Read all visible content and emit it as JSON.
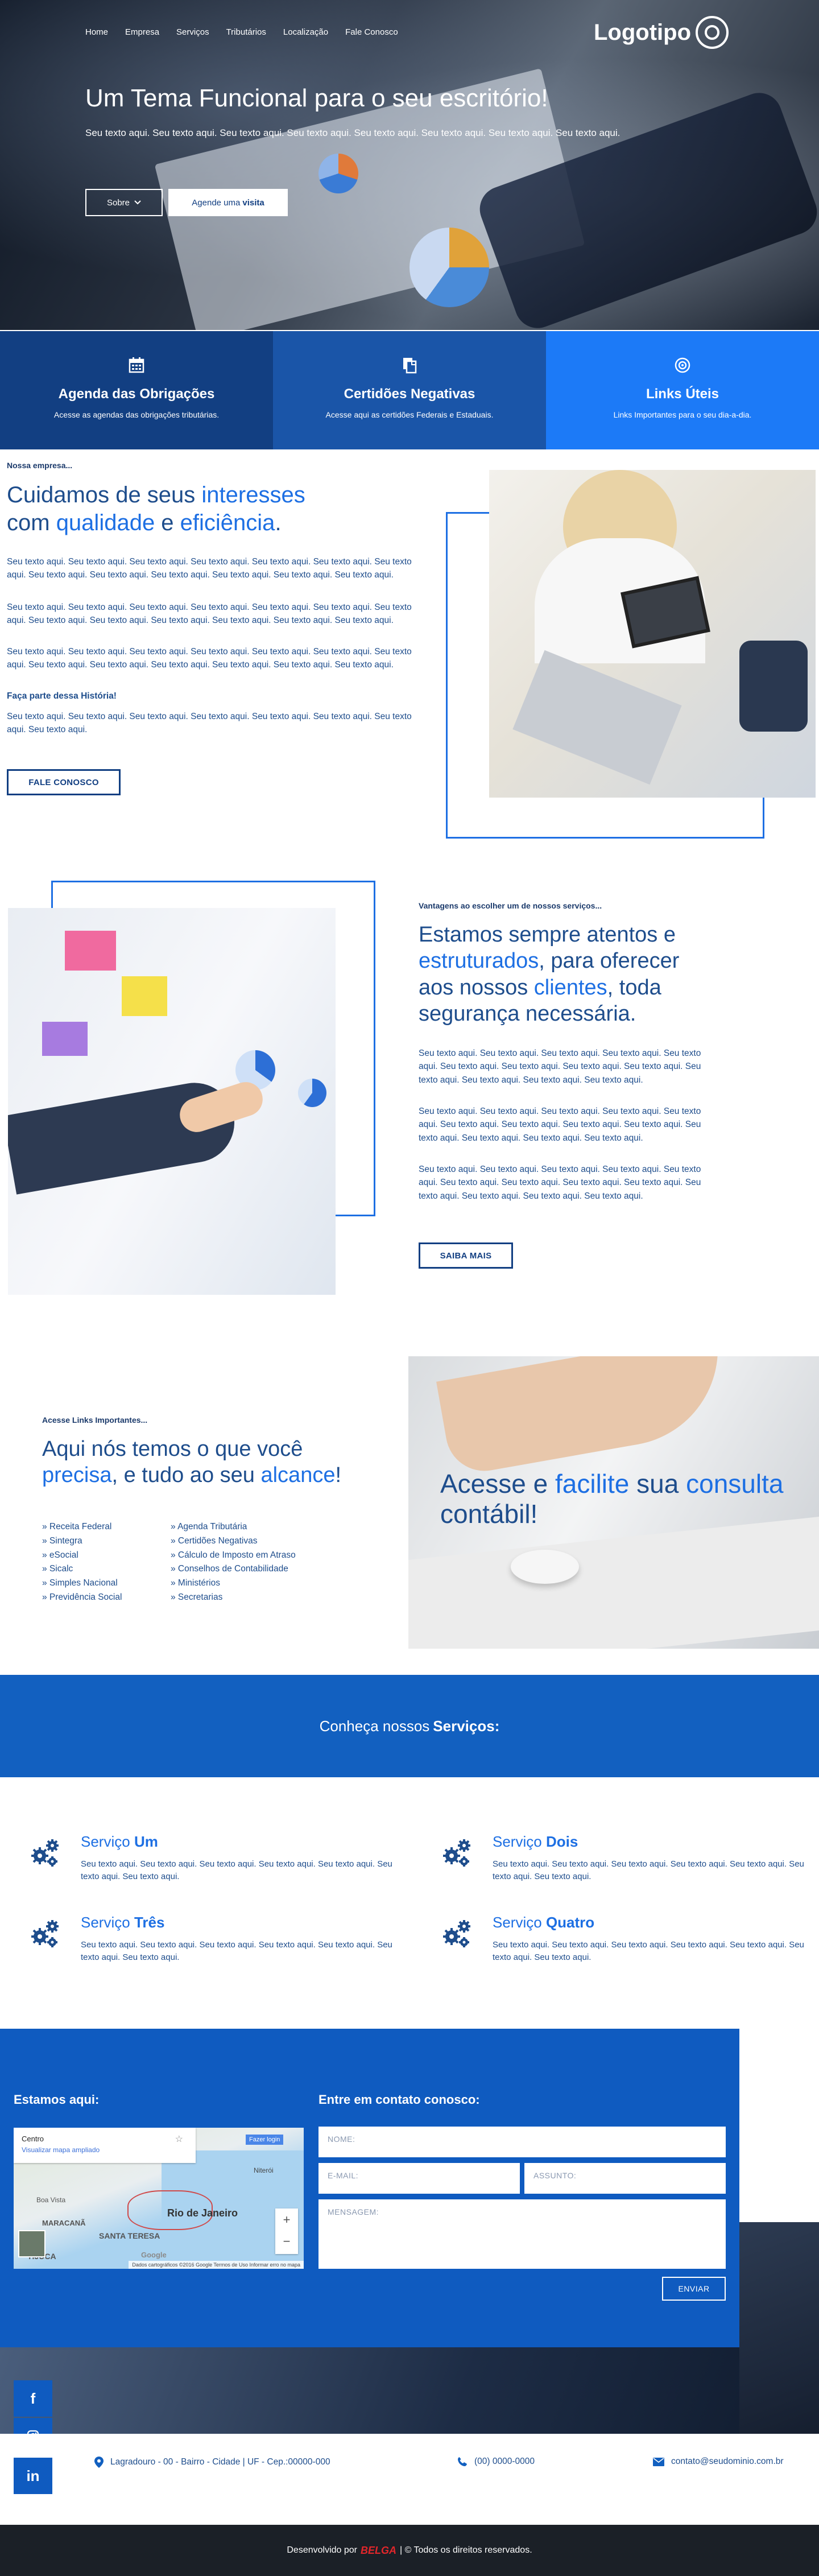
{
  "header": {
    "nav": [
      "Home",
      "Empresa",
      "Serviços",
      "Tributários",
      "Localização",
      "Fale Conosco"
    ],
    "logo_text": "Logotipo"
  },
  "hero": {
    "title": "Um Tema Funcional para o seu escritório!",
    "subtitle": "Seu texto aqui. Seu texto aqui. Seu texto aqui. Seu texto aqui. Seu texto aqui. Seu texto aqui. Seu texto aqui. Seu texto aqui.",
    "btn_sobre": "Sobre",
    "btn_visita_prefix": "Agende uma",
    "btn_visita_bold": "visita"
  },
  "features": [
    {
      "title": "Agenda das Obrigações",
      "text": "Acesse as agendas das obrigações tributárias.",
      "color": "#123f82",
      "icon": "calendar-icon"
    },
    {
      "title": "Certidões Negativas",
      "text": "Acesse aqui as certidões Federais e Estaduais.",
      "color": "#1a55a8",
      "icon": "documents-icon"
    },
    {
      "title": "Links Úteis",
      "text": "Links Importantes para o seu dia-a-dia.",
      "color": "#1c7af7",
      "icon": "target-icon"
    }
  ],
  "about": {
    "kicker": "Nossa empresa...",
    "h_1": "Cuidamos de seus ",
    "h_2": "interesses",
    "h_3": "com ",
    "h_4": "qualidade",
    "h_5": " e ",
    "h_6": "eficiência",
    "h_7": ".",
    "p1": "Seu texto aqui. Seu texto aqui. Seu texto aqui. Seu texto aqui. Seu texto aqui. Seu texto aqui. Seu texto aqui. Seu texto aqui. Seu texto aqui. Seu texto aqui. Seu texto aqui. Seu texto aqui. Seu texto aqui.",
    "p2": "Seu texto aqui. Seu texto aqui. Seu texto aqui. Seu texto aqui. Seu texto aqui. Seu texto aqui. Seu texto aqui. Seu texto aqui. Seu texto aqui. Seu texto aqui. Seu texto aqui. Seu texto aqui. Seu texto aqui.",
    "p3": "Seu texto aqui. Seu texto aqui. Seu texto aqui. Seu texto aqui. Seu texto aqui. Seu texto aqui. Seu texto aqui. Seu texto aqui. Seu texto aqui. Seu texto aqui. Seu texto aqui. Seu texto aqui. Seu texto aqui.",
    "history_title": "Faça parte dessa História!",
    "p4": "Seu texto aqui. Seu texto aqui. Seu texto aqui. Seu texto aqui. Seu texto aqui. Seu texto aqui. Seu texto aqui. Seu texto aqui.",
    "button": "FALE CONOSCO"
  },
  "advantages": {
    "kicker": "Vantagens ao escolher um de nossos serviços...",
    "h_1": "Estamos sempre atentos e",
    "h_2": "estruturados",
    "h_3": ", para oferecer",
    "h_4": "aos nossos ",
    "h_5": "clientes",
    "h_6": ", toda",
    "h_7": "segurança necessária.",
    "p1": "Seu texto aqui. Seu texto aqui. Seu texto aqui. Seu texto aqui. Seu texto aqui. Seu texto aqui. Seu texto aqui. Seu texto aqui. Seu texto aqui. Seu texto aqui. Seu texto aqui. Seu texto aqui. Seu texto aqui.",
    "p2": "Seu texto aqui. Seu texto aqui. Seu texto aqui. Seu texto aqui. Seu texto aqui. Seu texto aqui. Seu texto aqui. Seu texto aqui. Seu texto aqui. Seu texto aqui. Seu texto aqui. Seu texto aqui. Seu texto aqui.",
    "p3": "Seu texto aqui. Seu texto aqui. Seu texto aqui. Seu texto aqui. Seu texto aqui. Seu texto aqui. Seu texto aqui. Seu texto aqui. Seu texto aqui. Seu texto aqui. Seu texto aqui. Seu texto aqui. Seu texto aqui.",
    "button": "SAIBA MAIS"
  },
  "links": {
    "kicker": "Acesse Links Importantes...",
    "h_1": "Aqui nós temos o que você",
    "h_2": "precisa",
    "h_3": ", e tudo ao seu ",
    "h_4": "alcance",
    "h_5": "!",
    "col1": [
      "» Receita Federal",
      "» Sintegra",
      "» eSocial",
      "» Sicalc",
      "» Simples Nacional",
      "» Previdência Social"
    ],
    "col2": [
      "» Agenda Tributária",
      "» Certidões Negativas",
      "» Cálculo de Imposto em Atraso",
      "» Conselhos de Contabilidade",
      "» Ministérios",
      "» Secretarias"
    ],
    "banner_1": "Acesse e ",
    "banner_2": "facilite",
    "banner_3": " sua ",
    "banner_4": "consulta",
    "banner_5": "contábil!"
  },
  "services": {
    "band_prefix": "Conheça nossos",
    "band_bold": "Serviços:",
    "items": [
      {
        "prefix": "Serviço",
        "name": "Um",
        "text": "Seu texto aqui. Seu texto aqui. Seu texto aqui. Seu texto aqui. Seu texto aqui. Seu texto aqui. Seu texto aqui."
      },
      {
        "prefix": "Serviço",
        "name": "Dois",
        "text": "Seu texto aqui. Seu texto aqui. Seu texto aqui. Seu texto aqui. Seu texto aqui. Seu texto aqui. Seu texto aqui."
      },
      {
        "prefix": "Serviço",
        "name": "Três",
        "text": "Seu texto aqui. Seu texto aqui. Seu texto aqui. Seu texto aqui. Seu texto aqui. Seu texto aqui. Seu texto aqui."
      },
      {
        "prefix": "Serviço",
        "name": "Quatro",
        "text": "Seu texto aqui. Seu texto aqui. Seu texto aqui. Seu texto aqui. Seu texto aqui. Seu texto aqui. Seu texto aqui."
      }
    ]
  },
  "contact": {
    "map_title": "Estamos aqui:",
    "form_title": "Entre em contato conosco:",
    "map": {
      "place": "Centro",
      "link": "Visualizar mapa ampliado",
      "tag": "Fazer login",
      "labels": [
        "Niterói",
        "Rio de Janeiro",
        "MARACANÃ",
        "SANTA TERESA",
        "Boa Vista",
        "TIJUCA"
      ],
      "footer": "Dados cartográficos ©2016 Google   Termos de Uso   Informar erro no mapa",
      "brand": "Google"
    },
    "nome": "NOME:",
    "email": "E-MAIL:",
    "assunto": "ASSUNTO:",
    "mensagem": "MENSAGEM:",
    "send": "ENVIAR"
  },
  "footer": {
    "address": "Lagradouro - 00 - Bairro - Cidade | UF - Cep.:00000-000",
    "phone": "(00) 0000-0000",
    "email": "contato@seudominio.com.br",
    "dev_prefix": "Desenvolvido por",
    "dev_brand": "BELGA",
    "dev_suffix": "| © Todos os direitos reservados.",
    "brand_color": "#e3262b"
  }
}
